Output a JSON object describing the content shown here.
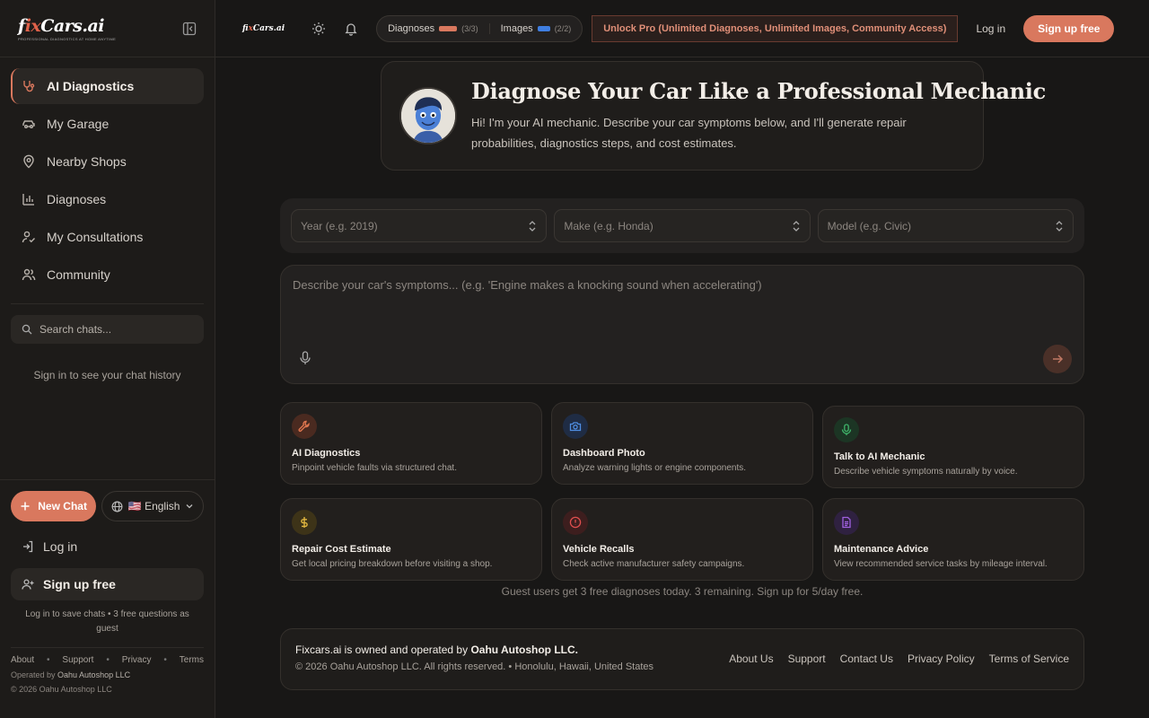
{
  "brand": {
    "name_prefix": "f",
    "name_red": "ix",
    "name_suffix": "Cars.ai",
    "tagline": "PROFESSIONAL DIAGNOSTICS AT HOME ANYTIME"
  },
  "sidebar": {
    "items": [
      {
        "label": "AI Diagnostics",
        "icon": "stethoscope-icon",
        "active": true
      },
      {
        "label": "My Garage",
        "icon": "car-icon"
      },
      {
        "label": "Nearby Shops",
        "icon": "map-pin-icon"
      },
      {
        "label": "Diagnoses",
        "icon": "bar-chart-icon"
      },
      {
        "label": "My Consultations",
        "icon": "user-check-icon"
      },
      {
        "label": "Community",
        "icon": "users-icon"
      }
    ],
    "search_placeholder": "Search chats...",
    "history_note": "Sign in to see your chat history",
    "new_chat_label": "New Chat",
    "language": "🇺🇸 English",
    "login_label": "Log in",
    "signup_label": "Sign up free",
    "hint": "Log in to save chats • 3 free questions as guest",
    "footer_links": [
      "About",
      "Support",
      "Privacy",
      "Terms"
    ],
    "operated_prefix": "Operated by ",
    "operated_by": "Oahu Autoshop LLC",
    "copyright": "© 2026 Oahu Autoshop LLC"
  },
  "topbar": {
    "diagnoses_label": "Diagnoses",
    "diagnoses_count": "(3/3)",
    "images_label": "Images",
    "images_count": "(2/2)",
    "unlock_label": "Unlock Pro (Unlimited Diagnoses, Unlimited Images, Community Access)",
    "login_label": "Log in",
    "signup_label": "Sign up free"
  },
  "hero": {
    "title": "Diagnose Your Car Like a Professional Mechanic",
    "description": "Hi! I'm your AI mechanic. Describe your car symptoms below, and I'll generate repair probabilities, diagnostics steps, and cost estimates."
  },
  "vehicle": {
    "year_placeholder": "Year (e.g. 2019)",
    "make_placeholder": "Make (e.g. Honda)",
    "model_placeholder": "Model (e.g. Civic)"
  },
  "composer": {
    "placeholder": "Describe your car's symptoms... (e.g. 'Engine makes a knocking sound when accelerating')"
  },
  "cards": [
    {
      "title": "AI Diagnostics",
      "desc": "Pinpoint vehicle faults via structured chat.",
      "icon": "wrench-icon",
      "color": "#e0764f"
    },
    {
      "title": "Dashboard Photo",
      "desc": "Analyze warning lights or engine components.",
      "icon": "camera-icon",
      "color": "#4f8de0"
    },
    {
      "title": "Talk to AI Mechanic",
      "desc": "Describe vehicle symptoms naturally by voice.",
      "icon": "mic-icon",
      "color": "#3fb56a"
    },
    {
      "title": "Repair Cost Estimate",
      "desc": "Get local pricing breakdown before visiting a shop.",
      "icon": "dollar-icon",
      "color": "#e0b53f"
    },
    {
      "title": "Vehicle Recalls",
      "desc": "Check active manufacturer safety campaigns.",
      "icon": "alert-circle-icon",
      "color": "#e04f4f"
    },
    {
      "title": "Maintenance Advice",
      "desc": "View recommended service tasks by mileage interval.",
      "icon": "file-text-icon",
      "color": "#a060e0"
    }
  ],
  "guest_note": "Guest users get 3 free diagnoses today. 3 remaining. Sign up for 5/day free.",
  "footer": {
    "own_prefix": "Fixcars.ai is owned and operated by ",
    "own_company": "Oahu Autoshop LLC.",
    "copyright": "© 2026 Oahu Autoshop LLC. All rights reserved. • Honolulu, Hawaii, United States",
    "links": [
      "About Us",
      "Support",
      "Contact Us",
      "Privacy Policy",
      "Terms of Service"
    ]
  }
}
